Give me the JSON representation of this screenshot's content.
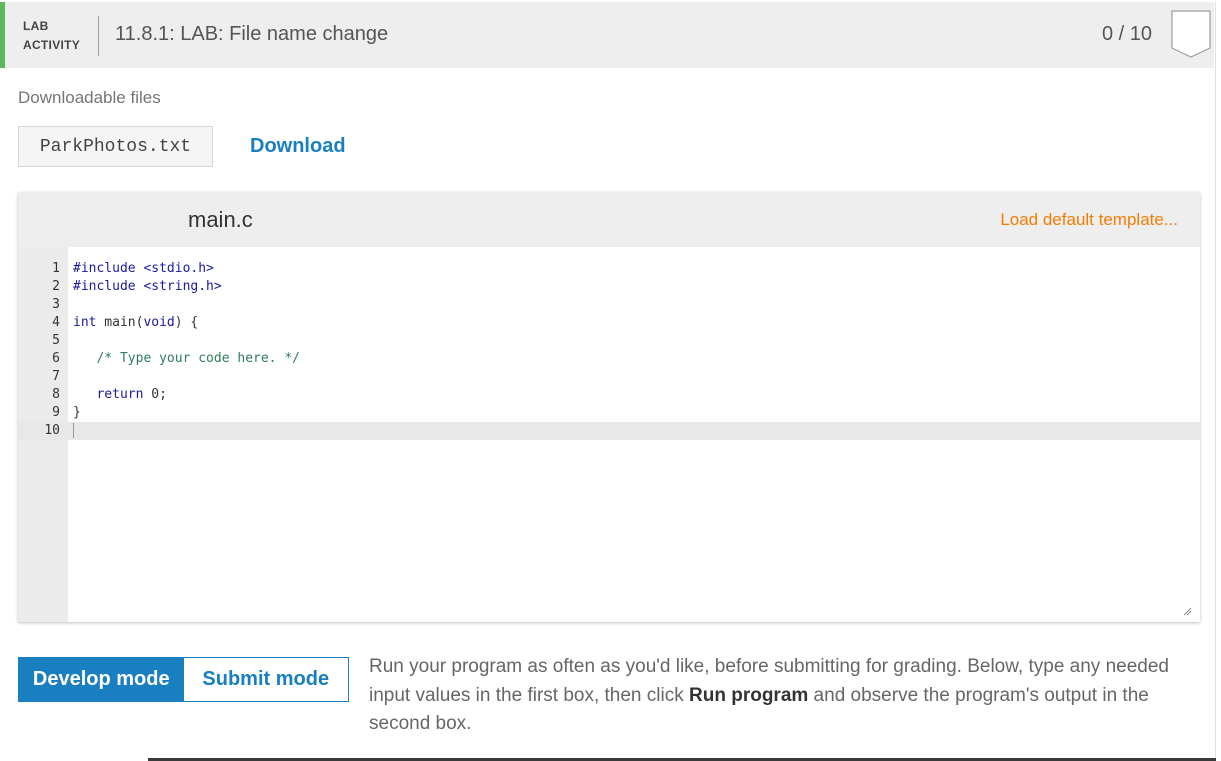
{
  "header": {
    "badge_line1": "LAB",
    "badge_line2": "ACTIVITY",
    "title": "11.8.1: LAB: File name change",
    "score": "0 / 10",
    "accent_color": "#5cb85c"
  },
  "downloads": {
    "label": "Downloadable files",
    "filename": "ParkPhotos.txt",
    "download_label": "Download"
  },
  "editor": {
    "filename": "main.c",
    "load_template_label": "Load default template...",
    "lines": [
      {
        "n": "1",
        "segments": [
          {
            "t": "#include <stdio.h>",
            "c": "kw"
          }
        ]
      },
      {
        "n": "2",
        "segments": [
          {
            "t": "#include <string.h>",
            "c": "kw"
          }
        ]
      },
      {
        "n": "3",
        "segments": []
      },
      {
        "n": "4",
        "segments": [
          {
            "t": "int",
            "c": "kw"
          },
          {
            "t": " main(",
            "c": ""
          },
          {
            "t": "void",
            "c": "kw"
          },
          {
            "t": ") {",
            "c": ""
          }
        ]
      },
      {
        "n": "5",
        "segments": []
      },
      {
        "n": "6",
        "segments": [
          {
            "t": "   ",
            "c": ""
          },
          {
            "t": "/* Type your code here. */",
            "c": "cm"
          }
        ]
      },
      {
        "n": "7",
        "segments": []
      },
      {
        "n": "8",
        "segments": [
          {
            "t": "   return ",
            "c": "kw"
          },
          {
            "t": "0",
            "c": ""
          },
          {
            "t": ";",
            "c": ""
          }
        ]
      },
      {
        "n": "9",
        "segments": [
          {
            "t": "}",
            "c": ""
          }
        ]
      },
      {
        "n": "10",
        "segments": [],
        "active": true
      }
    ]
  },
  "modes": {
    "develop_label": "Develop mode",
    "submit_label": "Submit mode",
    "active": "develop"
  },
  "instructions": {
    "before": "Run your program as often as you'd like, before submitting for grading. Below, type any needed input values in the first box, then click ",
    "bold": "Run program",
    "after": " and observe the program's output in the second box."
  }
}
